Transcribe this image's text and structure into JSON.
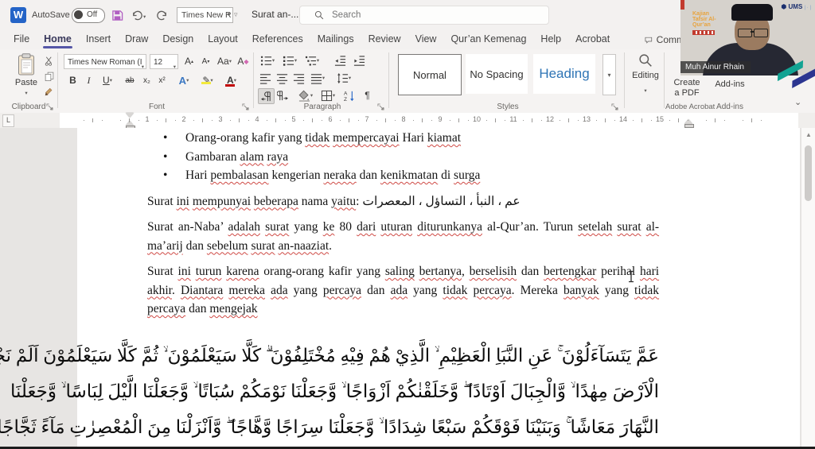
{
  "titlebar": {
    "word_logo": "W",
    "autosave_label": "AutoSave",
    "autosave_state": "Off",
    "quick_font": "Times New R",
    "doc_title": "Surat an-...",
    "search_placeholder": "Search"
  },
  "menubar": {
    "items": [
      "File",
      "Home",
      "Insert",
      "Draw",
      "Design",
      "Layout",
      "References",
      "Mailings",
      "Review",
      "View",
      "Qur’an Kemenag",
      "Help",
      "Acrobat"
    ],
    "active_index": 1,
    "comments_label": "Comm"
  },
  "ribbon": {
    "clipboard": {
      "paste": "Paste",
      "label": "Clipboard"
    },
    "font": {
      "family": "Times New Roman (I",
      "size": "12",
      "label": "Font",
      "grow": "A",
      "shrink": "A",
      "case": "Aa",
      "clear": "A",
      "bold": "B",
      "italic": "I",
      "underline": "U",
      "strike": "ab",
      "subscript": "x₂",
      "superscript": "x²",
      "effects": "A",
      "highlight_color": "#f3e93c",
      "font_color": "A",
      "font_color_bar": "#c00000"
    },
    "paragraph": {
      "label": "Paragraph",
      "pilcrow": "¶"
    },
    "styles": {
      "label": "Styles",
      "items": [
        "Normal",
        "No Spacing",
        "Heading"
      ],
      "selected": "Normal",
      "heading_color": "#2e74b5"
    },
    "editing": {
      "label": "Editing"
    },
    "acrobat": {
      "button_line1": "Create",
      "button_line2": "a PDF",
      "label": "Adobe Acrobat"
    },
    "addins": {
      "button": "Add-ins",
      "label": "Add-ins"
    }
  },
  "ruler": {
    "numbers": [
      "1",
      "2",
      "3",
      "4",
      "5",
      "6",
      "7",
      "8",
      "9",
      "10",
      "11",
      "12",
      "13",
      "14",
      "15"
    ]
  },
  "video": {
    "participant_name": "Muh Ainur Rhain",
    "corner_title_lines": [
      "Kajian",
      "Tafsir Al-",
      "Qur’an"
    ],
    "logo_text": "UMS",
    "accent_teal": "#12a393",
    "accent_navy": "#2b3590"
  },
  "document": {
    "spell_underline_color": "#cf4a45",
    "bullets": [
      [
        {
          "t": "Orang-orang kafir yang "
        },
        {
          "t": "tidak",
          "m": 1
        },
        {
          "t": " "
        },
        {
          "t": "mempercayai",
          "m": 1
        },
        {
          "t": " Hari "
        },
        {
          "t": "kiamat",
          "m": 1
        }
      ],
      [
        {
          "t": "Gambaran "
        },
        {
          "t": "alam",
          "m": 1
        },
        {
          "t": " "
        },
        {
          "t": "raya",
          "m": 1
        }
      ],
      [
        {
          "t": "Hari "
        },
        {
          "t": "pembalasan",
          "m": 1
        },
        {
          "t": " kengerian "
        },
        {
          "t": "neraka",
          "m": 1
        },
        {
          "t": " dan "
        },
        {
          "t": "kenikmatan",
          "m": 1
        },
        {
          "t": " di "
        },
        {
          "t": "surga",
          "m": 1
        }
      ]
    ],
    "paragraphs": [
      [
        {
          "t": "Surat "
        },
        {
          "t": "ini",
          "m": 1
        },
        {
          "t": " "
        },
        {
          "t": "mempunyai",
          "m": 1
        },
        {
          "t": " "
        },
        {
          "t": "beberapa",
          "m": 1
        },
        {
          "t": " nama "
        },
        {
          "t": "yaitu",
          "m": 1
        },
        {
          "t": ":  "
        },
        {
          "t": "عم ، النبأ ، التساؤل ، المعصرات",
          "ar": 1
        }
      ],
      [
        {
          "t": "Surat an-Naba’ "
        },
        {
          "t": "adalah",
          "m": 1
        },
        {
          "t": " "
        },
        {
          "t": "surat",
          "m": 1
        },
        {
          "t": " yang "
        },
        {
          "t": "ke",
          "m": 1
        },
        {
          "t": " 80 "
        },
        {
          "t": "dari",
          "m": 1
        },
        {
          "t": " "
        },
        {
          "t": "uturan",
          "m": 1
        },
        {
          "t": " "
        },
        {
          "t": "diturunkanya",
          "m": 1
        },
        {
          "t": " al-Qur’an.  Turun "
        },
        {
          "t": "setelah",
          "m": 1
        },
        {
          "t": " "
        },
        {
          "t": "surat",
          "m": 1
        },
        {
          "t": " "
        },
        {
          "t": "al-ma’arij",
          "m": 1
        },
        {
          "t": " dan "
        },
        {
          "t": "sebelum",
          "m": 1
        },
        {
          "t": " "
        },
        {
          "t": "surat",
          "m": 1
        },
        {
          "t": " "
        },
        {
          "t": "an-naaziat",
          "m": 1
        },
        {
          "t": "."
        }
      ],
      [
        {
          "t": "Surat "
        },
        {
          "t": "ini",
          "m": 1
        },
        {
          "t": " "
        },
        {
          "t": "turun",
          "m": 1
        },
        {
          "t": " "
        },
        {
          "t": "karena",
          "m": 1
        },
        {
          "t": " orang-orang kafir yang "
        },
        {
          "t": "saling",
          "m": 1
        },
        {
          "t": " "
        },
        {
          "t": "bertanya",
          "m": 1
        },
        {
          "t": ", "
        },
        {
          "t": "berselisih",
          "m": 1
        },
        {
          "t": " dan "
        },
        {
          "t": "bertengkar",
          "m": 1
        },
        {
          "t": " perihal "
        },
        {
          "t": "hari",
          "m": 1
        },
        {
          "t": " "
        },
        {
          "t": "akhir",
          "m": 1
        },
        {
          "t": ". "
        },
        {
          "t": "Diantara",
          "m": 1
        },
        {
          "t": " "
        },
        {
          "t": "mereka",
          "m": 1
        },
        {
          "t": " "
        },
        {
          "t": "ada",
          "m": 1
        },
        {
          "t": " yang "
        },
        {
          "t": "percaya",
          "m": 1
        },
        {
          "t": " dan "
        },
        {
          "t": "ada",
          "m": 1
        },
        {
          "t": " yang "
        },
        {
          "t": "tidak",
          "m": 1
        },
        {
          "t": " "
        },
        {
          "t": "percaya",
          "m": 1
        },
        {
          "t": ". Mereka "
        },
        {
          "t": "banyak",
          "m": 1
        },
        {
          "t": " yang "
        },
        {
          "t": "tidak",
          "m": 1
        },
        {
          "t": " "
        },
        {
          "t": "percaya",
          "m": 1
        },
        {
          "t": " dan "
        },
        {
          "t": "mengejak",
          "m": 1
        }
      ]
    ],
    "arabic_lines": [
      "عَمَّ يَتَسَآءَلُوْنَ ۚ عَنِ النَّبَاِ الْعَظِيْمِ ۙ الَّذِيْ هُمْ فِيْهِ مُخْتَلِفُوْنَ ۗ كَلَّا سَيَعْلَمُوْنَ ۙ ثُمَّ كَلَّا سَيَعْلَمُوْنَ اَلَمْ نَجْعَلِ",
      "الْاَرْضَ مِهٰدًا ۙ وَّالْجِبَالَ اَوْتَادًا ۖ وَّخَلَقْنٰكُمْ اَزْوَاجًا ۙ وَّجَعَلْنَا نَوْمَكُمْ سُبَاتًا ۙ وَّجَعَلْنَا الَّيْلَ لِبَاسًا ۙ وَّجَعَلْنَا",
      "النَّهَارَ مَعَاشًا ۚ وَبَنَيْنَا فَوْقَكُمْ سَبْعًا شِدَادًا ۙ وَّجَعَلْنَا سِرَاجًا وَّهَّاجًا ۖ وَّاَنْزَلْنَا مِنَ الْمُعْصِرٰتِ مَآءً ثَجَّاجًا"
    ]
  }
}
